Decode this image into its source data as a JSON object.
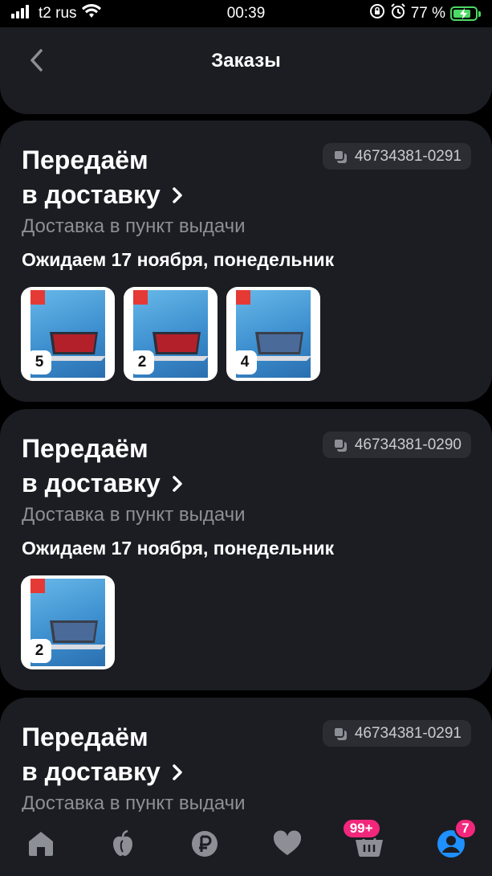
{
  "status_bar": {
    "carrier": "t2 rus",
    "time": "00:39",
    "battery": "77 %"
  },
  "header": {
    "title": "Заказы"
  },
  "orders": [
    {
      "status_line1": "Передаём",
      "status_line2": "в доставку",
      "number": "46734381-0291",
      "delivery_type": "Доставка в пункт выдачи",
      "date": "Ожидаем 17 ноября, понедельник",
      "items": [
        {
          "count": "5"
        },
        {
          "count": "2"
        },
        {
          "count": "4"
        }
      ]
    },
    {
      "status_line1": "Передаём",
      "status_line2": "в доставку",
      "number": "46734381-0290",
      "delivery_type": "Доставка в пункт выдачи",
      "date": "Ожидаем 17 ноября, понедельник",
      "items": [
        {
          "count": "2"
        }
      ]
    },
    {
      "status_line1": "Передаём",
      "status_line2": "в доставку",
      "number": "46734381-0291",
      "delivery_type": "Доставка в пункт выдачи"
    }
  ],
  "nav": {
    "items": [
      {
        "icon": "home-icon"
      },
      {
        "icon": "apple-icon"
      },
      {
        "icon": "ruble-icon"
      },
      {
        "icon": "heart-icon"
      },
      {
        "icon": "basket-icon",
        "badge": "99+"
      },
      {
        "icon": "profile-icon",
        "badge": "7"
      }
    ]
  },
  "colors": {
    "background": "#000000",
    "card": "#1c1d22",
    "accent_badge": "#f2277c",
    "profile_active": "#1e90ff"
  }
}
